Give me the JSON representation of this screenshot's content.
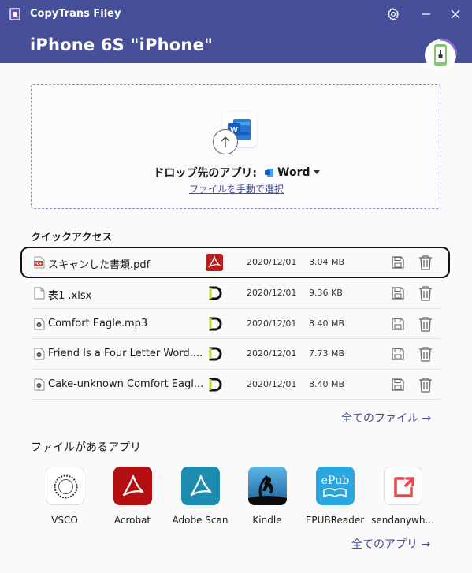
{
  "window": {
    "app_name": "CopyTrans Filey",
    "device_title": "iPhone 6S \"iPhone\"",
    "colors": {
      "header": "#474f99",
      "accent": "#474f99"
    }
  },
  "dropzone": {
    "label": "ドロップ先のアプリ:",
    "selected_app": "Word",
    "manual_link": "ファイルを手動で選択",
    "icon": "word-icon"
  },
  "quick_access": {
    "title": "クイックアクセス",
    "files": [
      {
        "name": "スキャンした書類.pdf",
        "type_icon": "pdf-file-icon",
        "app_icon": "acrobat-icon",
        "date": "2020/12/01",
        "size": "8.04 MB",
        "selected": true
      },
      {
        "name": "表1 .xlsx",
        "type_icon": "document-file-icon",
        "app_icon": "documents-app-icon",
        "date": "2020/12/01",
        "size": "9.36 KB"
      },
      {
        "name": "Comfort Eagle.mp3",
        "type_icon": "audio-file-icon",
        "app_icon": "documents-app-icon",
        "date": "2020/12/01",
        "size": "8.40 MB"
      },
      {
        "name": "Friend Is a Four Letter Word....",
        "type_icon": "audio-file-icon",
        "app_icon": "documents-app-icon",
        "date": "2020/12/01",
        "size": "7.73 MB"
      },
      {
        "name": "Cake-unknown Comfort Eagl...",
        "type_icon": "audio-file-icon",
        "app_icon": "documents-app-icon",
        "date": "2020/12/01",
        "size": "8.40 MB"
      }
    ],
    "all_files_link": "全てのファイル →"
  },
  "apps_section": {
    "title": "ファイルがあるアプリ",
    "apps": [
      {
        "name": "VSCO",
        "icon": "vsco-icon"
      },
      {
        "name": "Acrobat",
        "icon": "acrobat-icon"
      },
      {
        "name": "Adobe Scan",
        "icon": "adobe-scan-icon"
      },
      {
        "name": "Kindle",
        "icon": "kindle-icon"
      },
      {
        "name": "EPUBReader",
        "icon": "epub-reader-icon"
      },
      {
        "name": "sendanywh...",
        "icon": "send-anywhere-icon"
      }
    ],
    "all_apps_link": "全てのアプリ →"
  }
}
